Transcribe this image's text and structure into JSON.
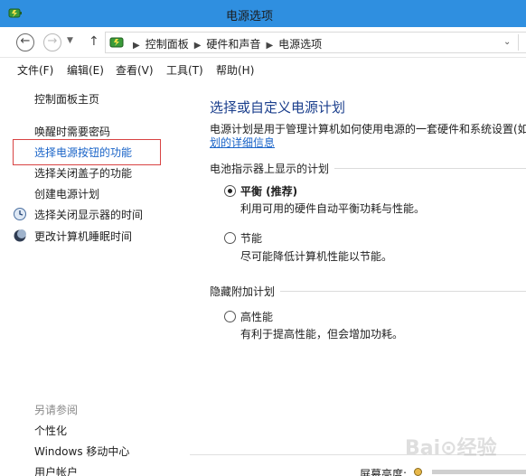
{
  "window": {
    "title": "电源选项"
  },
  "address": {
    "crumbs": [
      "控制面板",
      "硬件和声音",
      "电源选项"
    ]
  },
  "menu": [
    "文件(F)",
    "编辑(E)",
    "查看(V)",
    "工具(T)",
    "帮助(H)"
  ],
  "sidebar": {
    "home": "控制面板主页",
    "items": [
      "唤醒时需要密码",
      "选择电源按钮的功能",
      "选择关闭盖子的功能",
      "创建电源计划",
      "选择关闭显示器的时间",
      "更改计算机睡眠时间"
    ],
    "see_also_label": "另请参阅",
    "see_also": [
      "个性化",
      "Windows 移动中心",
      "用户帐户"
    ]
  },
  "main": {
    "title": "选择或自定义电源计划",
    "desc": "电源计划是用于管理计算机如何使用电源的一套硬件和系统设置(如",
    "desc_link": "划的详细信息",
    "battery_header": "电池指示器上显示的计划",
    "hidden_header": "隐藏附加计划",
    "plans": [
      {
        "name": "平衡 (推荐)",
        "desc": "利用可用的硬件自动平衡功耗与性能。",
        "selected": true
      },
      {
        "name": "节能",
        "desc": "尽可能降低计算机性能以节能。",
        "selected": false
      },
      {
        "name": "高性能",
        "desc": "有利于提高性能，但会增加功耗。",
        "selected": false
      }
    ]
  },
  "footer": {
    "brightness_label": "屏幕亮度:"
  },
  "watermark": "Bai⊙经验",
  "colors": {
    "titlebar": "#2f8fe0",
    "link": "#1a64c8",
    "highlight_box": "#d84343"
  }
}
